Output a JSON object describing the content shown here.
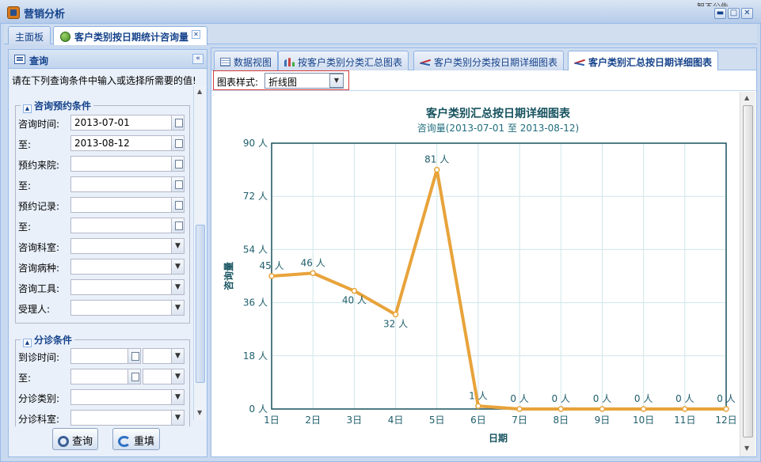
{
  "window": {
    "title": "营销分析",
    "bg_partial_text": "智不公告..."
  },
  "top_tabs": [
    {
      "label": "主面板"
    },
    {
      "label": "客户类别按日期统计咨询量"
    }
  ],
  "query_panel": {
    "title": "查询",
    "hint": "请在下列查询条件中输入或选择所需要的值!",
    "consult_section": {
      "legend": "咨询预约条件",
      "fields": [
        {
          "label": "咨询时间:",
          "value": "2013-07-01",
          "kind": "date"
        },
        {
          "label": "至:",
          "value": "2013-08-12",
          "kind": "date"
        },
        {
          "label": "预约来院:",
          "value": "",
          "kind": "date"
        },
        {
          "label": "至:",
          "value": "",
          "kind": "date"
        },
        {
          "label": "预约记录:",
          "value": "",
          "kind": "date"
        },
        {
          "label": "至:",
          "value": "",
          "kind": "date"
        },
        {
          "label": "咨询科室:",
          "value": "",
          "kind": "select"
        },
        {
          "label": "咨询病种:",
          "value": "",
          "kind": "select"
        },
        {
          "label": "咨询工具:",
          "value": "",
          "kind": "select"
        },
        {
          "label": "受理人:",
          "value": "",
          "kind": "select"
        }
      ]
    },
    "triage_section": {
      "legend": "分诊条件",
      "fields": [
        {
          "label": "到诊时间:",
          "value": "",
          "kind": "datetime"
        },
        {
          "label": "至:",
          "value": "",
          "kind": "datetime"
        },
        {
          "label": "分诊类别:",
          "value": "",
          "kind": "select"
        },
        {
          "label": "分诊科室:",
          "value": "",
          "kind": "select"
        }
      ]
    },
    "buttons": {
      "query": "查询",
      "reset": "重填"
    }
  },
  "sub_tabs": [
    {
      "label": "数据视图",
      "icon": "grid-icon"
    },
    {
      "label": "按客户类别分类汇总图表",
      "icon": "bar-chart-icon"
    },
    {
      "label": "客户类别分类按日期详细图表",
      "icon": "line-chart-icon"
    },
    {
      "label": "客户类别汇总按日期详细图表",
      "icon": "line-chart-icon"
    }
  ],
  "toolbar": {
    "style_label": "图表样式:",
    "style_value": "折线图"
  },
  "chart_data": {
    "type": "line",
    "title": "客户类别汇总按日期详细图表",
    "subtitle": "咨询量(2013-07-01 至 2013-08-12)",
    "xlabel": "日期",
    "ylabel": "咨询量",
    "categories": [
      "1日",
      "2日",
      "3日",
      "4日",
      "5日",
      "6日",
      "7日",
      "8日",
      "9日",
      "10日",
      "11日",
      "12日"
    ],
    "values": [
      45,
      46,
      40,
      32,
      81,
      1,
      0,
      0,
      0,
      0,
      0,
      0
    ],
    "value_unit": "人",
    "ylim": [
      0,
      90
    ],
    "yticks": [
      0,
      18,
      36,
      54,
      72,
      90
    ],
    "grid": true,
    "line_color": "#e8a33a"
  }
}
